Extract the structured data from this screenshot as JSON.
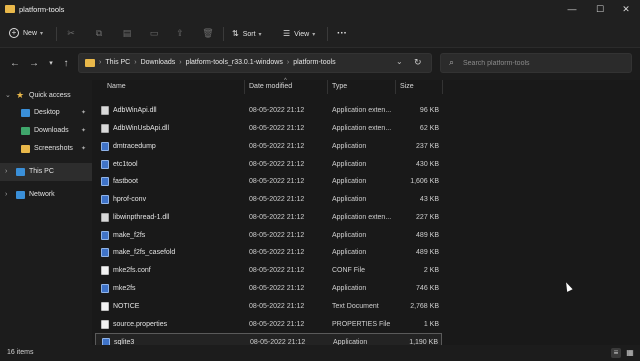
{
  "window": {
    "title": "platform-tools",
    "minimize_glyph": "—",
    "maximize_glyph": "☐",
    "close_glyph": "✕"
  },
  "toolbar": {
    "new_label": "New",
    "sort_label": "Sort",
    "view_label": "View",
    "more_glyph": "···"
  },
  "address": {
    "crumbs": [
      "This PC",
      "Downloads",
      "platform-tools_r33.0.1-windows",
      "platform-tools"
    ],
    "search_placeholder": "Search platform-tools"
  },
  "sidebar": {
    "items": [
      {
        "label": "Quick access",
        "icon": "star-icon",
        "color": "#e9b84a"
      },
      {
        "label": "Desktop",
        "icon": "desktop-icon",
        "color": "#3a8fd8"
      },
      {
        "label": "Downloads",
        "icon": "download-icon",
        "color": "#3fa66b"
      },
      {
        "label": "Screenshots",
        "icon": "folder-icon",
        "color": "#e9b84a"
      },
      {
        "label": "This PC",
        "icon": "computer-icon",
        "color": "#3a8fd8"
      },
      {
        "label": "Network",
        "icon": "network-icon",
        "color": "#3a8fd8"
      }
    ]
  },
  "columns": {
    "name": "Name",
    "date": "Date modified",
    "type": "Type",
    "size": "Size"
  },
  "files": [
    {
      "name": "AdbWinApi.dll",
      "date": "08-05-2022 21:12",
      "type": "Application exten...",
      "size": "96 KB",
      "icon": "dll"
    },
    {
      "name": "AdbWinUsbApi.dll",
      "date": "08-05-2022 21:12",
      "type": "Application exten...",
      "size": "62 KB",
      "icon": "dll"
    },
    {
      "name": "dmtracedump",
      "date": "08-05-2022 21:12",
      "type": "Application",
      "size": "237 KB",
      "icon": "app"
    },
    {
      "name": "etc1tool",
      "date": "08-05-2022 21:12",
      "type": "Application",
      "size": "430 KB",
      "icon": "app"
    },
    {
      "name": "fastboot",
      "date": "08-05-2022 21:12",
      "type": "Application",
      "size": "1,606 KB",
      "icon": "app"
    },
    {
      "name": "hprof-conv",
      "date": "08-05-2022 21:12",
      "type": "Application",
      "size": "43 KB",
      "icon": "app"
    },
    {
      "name": "libwinpthread-1.dll",
      "date": "08-05-2022 21:12",
      "type": "Application exten...",
      "size": "227 KB",
      "icon": "dll"
    },
    {
      "name": "make_f2fs",
      "date": "08-05-2022 21:12",
      "type": "Application",
      "size": "489 KB",
      "icon": "app"
    },
    {
      "name": "make_f2fs_casefold",
      "date": "08-05-2022 21:12",
      "type": "Application",
      "size": "489 KB",
      "icon": "app"
    },
    {
      "name": "mke2fs.conf",
      "date": "08-05-2022 21:12",
      "type": "CONF File",
      "size": "2 KB",
      "icon": "txt"
    },
    {
      "name": "mke2fs",
      "date": "08-05-2022 21:12",
      "type": "Application",
      "size": "746 KB",
      "icon": "app"
    },
    {
      "name": "NOTICE",
      "date": "08-05-2022 21:12",
      "type": "Text Document",
      "size": "2,768 KB",
      "icon": "txt"
    },
    {
      "name": "source.properties",
      "date": "08-05-2022 21:12",
      "type": "PROPERTIES File",
      "size": "1 KB",
      "icon": "txt"
    },
    {
      "name": "sqlite3",
      "date": "08-05-2022 21:12",
      "type": "Application",
      "size": "1,190 KB",
      "icon": "app",
      "selected": true
    }
  ],
  "status": {
    "count": "16 items"
  }
}
